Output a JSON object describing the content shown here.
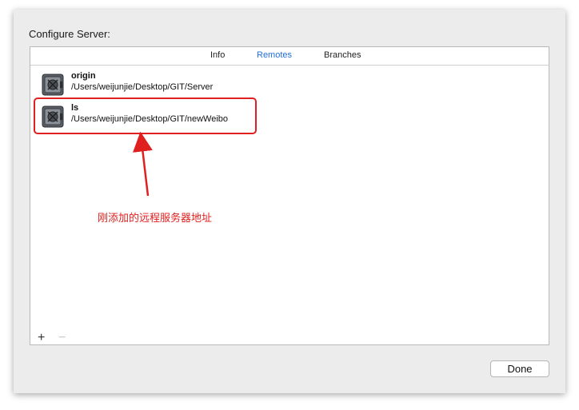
{
  "sheet": {
    "title": "Configure Server:"
  },
  "tabs": [
    {
      "label": "Info",
      "active": false
    },
    {
      "label": "Remotes",
      "active": true
    },
    {
      "label": "Branches",
      "active": false
    }
  ],
  "remotes": [
    {
      "name": "origin",
      "path": "/Users/weijunjie/Desktop/GIT/Server",
      "icon": "safe-icon"
    },
    {
      "name": "ls",
      "path": "/Users/weijunjie/Desktop/GIT/newWeibo",
      "icon": "safe-icon"
    }
  ],
  "annotation": {
    "text": "刚添加的远程服务器地址",
    "color": "#e0201f"
  },
  "footer": {
    "add_label": "+",
    "remove_label": "−"
  },
  "buttons": {
    "done_label": "Done"
  },
  "colors": {
    "accent": "#1f6fd6",
    "annotation": "#e0201f",
    "sheet_bg": "#ececec"
  }
}
